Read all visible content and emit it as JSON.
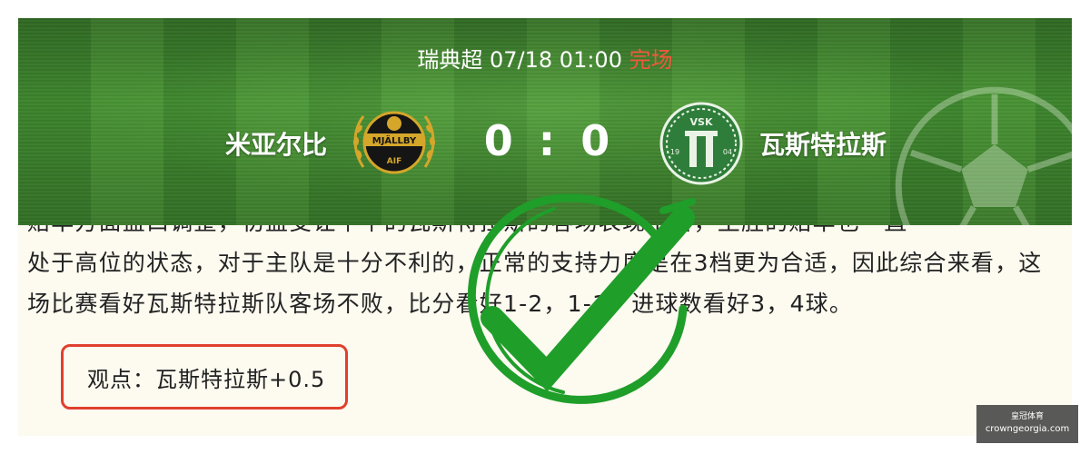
{
  "match": {
    "league": "瑞典超",
    "datetime": "07/18 01:00",
    "status": "完场",
    "home_team": "米亚尔比",
    "away_team": "瓦斯特拉斯",
    "score": "0 : 0",
    "home_logo_text": "MJÄLLBY",
    "home_logo_subtext": "AIF",
    "away_logo_text": "VSK",
    "away_logo_years": [
      "19",
      "04"
    ]
  },
  "article": {
    "lines": [
      "赔率方面盘口调整，初盘受让平半的瓦斯特拉斯的客场表现不俗，主胜的赔率也一直",
      "处于高位的状态，对于主队是十分不利的，正常的支持力度是在3档更为合适，因此综合来看，这",
      "场比赛看好瓦斯特拉斯队客场不败，比分看好1-2，1-1，进球数看好3，4球。"
    ],
    "viewpoint": "观点：瓦斯特拉斯+0.5"
  },
  "stamp": {
    "icon": "check-stamp-icon",
    "color": "#1f9e2a"
  },
  "watermark": {
    "label": "皇冠体育",
    "site": "crowngeorgia.com"
  },
  "colors": {
    "banner": "#3f8a2e",
    "status": "#ef5a3a",
    "highlight_border": "#e0402e",
    "article_bg": "#fdfaf0"
  }
}
